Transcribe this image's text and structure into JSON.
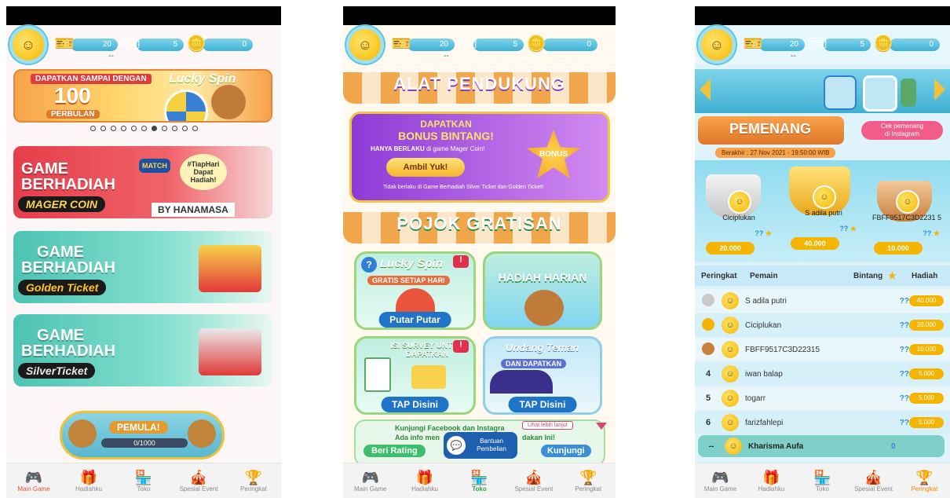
{
  "currency": {
    "silver": "20",
    "golden": "5",
    "coin": "0",
    "sub": "--"
  },
  "nav": [
    {
      "label": "Main Game",
      "icon": "gamepad-icon"
    },
    {
      "label": "Hadiahku",
      "icon": "gift-icon"
    },
    {
      "label": "Toko",
      "icon": "store-icon"
    },
    {
      "label": "Spesial Event",
      "icon": "event-icon"
    },
    {
      "label": "Peringkat",
      "icon": "trophy-icon"
    }
  ],
  "screen1": {
    "promo": {
      "line1": "DAPATKAN SAMPAI DENGAN",
      "brand": "Lucky Spin",
      "amount": "100",
      "unit": "PERBULAN"
    },
    "cards": [
      {
        "title1": "GAME",
        "title2": "BERHADIAH",
        "ribbon": "MAGER COIN",
        "badge": "#TiapHari Dapat Hadiah!",
        "by": "BY HANAMASA",
        "match": "MATCH"
      },
      {
        "title1": "GAME",
        "title2": "BERHADIAH",
        "ribbon": "Golden Ticket"
      },
      {
        "title1": "GAME",
        "title2": "BERHADIAH",
        "ribbon": "SilverTicket"
      }
    ],
    "rank": {
      "label": "PEMULA!",
      "progress": "0/1000",
      "fraction": 0
    }
  },
  "screen2": {
    "section1": "ALAT PENDUKUNG",
    "bonus": {
      "title1": "DAPATKAN",
      "title2": "BONUS BINTANG!",
      "note_prefix": "HANYA BERLAKU",
      "note_suffix": "di game Mager Coin!",
      "button": "Ambil Yuk!",
      "badge": "BONUS",
      "disclaimer": "Tidak berlaku di Game Berhadiah Silver Ticket dan Golden Ticket!"
    },
    "section2": "POJOK GRATISAN",
    "tiles": [
      {
        "title": "Lucky Spin",
        "sub": "GRATIS SETIAP HARI",
        "button": "Putar Putar"
      },
      {
        "title": "HADIAH HARIAN",
        "sub": "",
        "button": ""
      },
      {
        "title": "ISI SURVEY UNTUK DAPATKAN",
        "sub": "",
        "button": "TAP Disini"
      },
      {
        "title": "Undang Teman",
        "sub": "DAN DAPATKAN",
        "button": "TAP Disini"
      }
    ],
    "footer": {
      "text1": "Kunjungi Facebook dan Instagra",
      "text2": "Ada info men",
      "text3": "dakan Ini!",
      "more": "Lihat lebih lanjut",
      "help1": "Bantuan",
      "help2": "Pembelian",
      "rating": "Beri Rating",
      "kunjungi": "Kunjungi"
    }
  },
  "screen3": {
    "banner": {
      "title": "PEMENANG",
      "link1": "Cek pemenang",
      "link2": "di Instagram",
      "deadline": "Berakhir : 27 Nov 2021 - 19:50:00 WIB"
    },
    "podium": [
      {
        "place": "2",
        "name": "Ciciplukan",
        "stars": "??",
        "prize": "20.000"
      },
      {
        "place": "1",
        "name": "S adila putri",
        "stars": "??",
        "prize": "40.000"
      },
      {
        "place": "3",
        "name": "FBFF9517C3D2231 5",
        "stars": "??",
        "prize": "10.000"
      }
    ],
    "headers": {
      "rank": "Peringkat",
      "player": "Pemain",
      "stars": "Bintang",
      "prize": "Hadiah"
    },
    "rows": [
      {
        "rank": "",
        "name": "S adila putri",
        "stars": "??",
        "prize": "40.000"
      },
      {
        "rank": "",
        "name": "Ciciplukan",
        "stars": "??",
        "prize": "20.000"
      },
      {
        "rank": "",
        "name": "FBFF9517C3D22315",
        "stars": "??",
        "prize": "10.000"
      },
      {
        "rank": "4",
        "name": "iwan balap",
        "stars": "??",
        "prize": "5.000"
      },
      {
        "rank": "5",
        "name": "togarr",
        "stars": "??",
        "prize": "5.000"
      },
      {
        "rank": "6",
        "name": "farizfahlepi",
        "stars": "??",
        "prize": "5.000"
      }
    ],
    "me": {
      "rank": "--",
      "name": "Kharisma Aufa",
      "stars": "0"
    }
  }
}
